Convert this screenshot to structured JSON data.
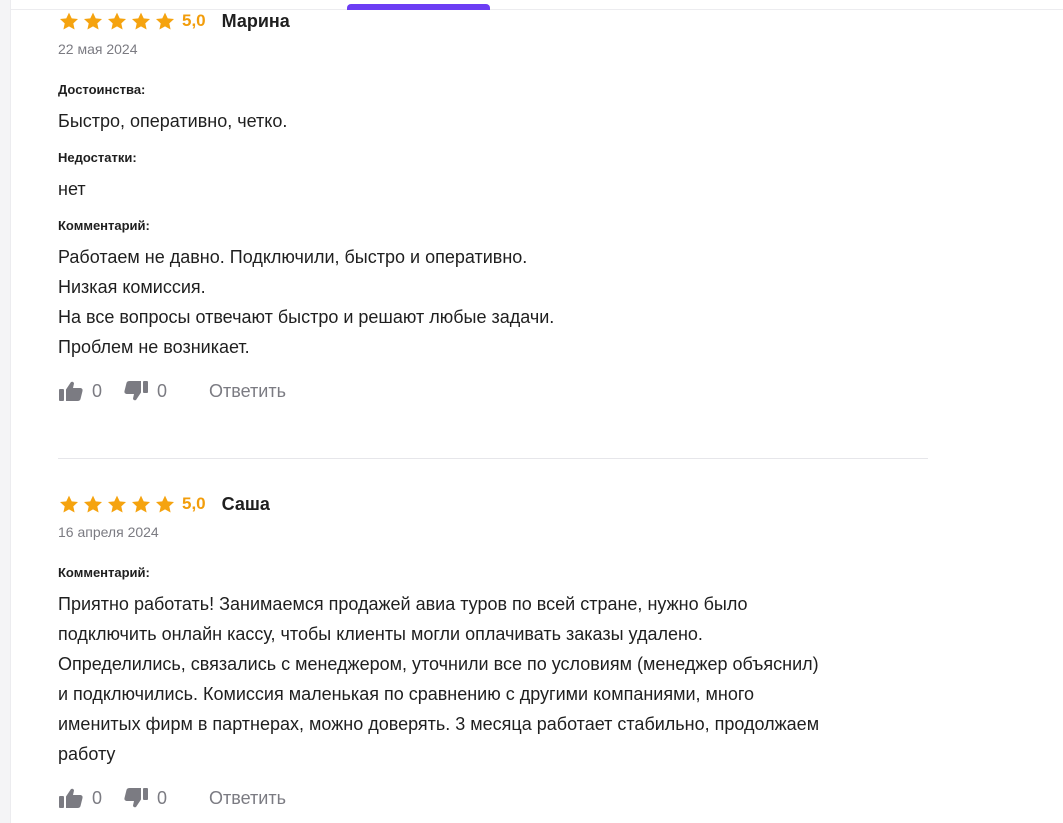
{
  "reviews": [
    {
      "stars": 5,
      "rating": "5,0",
      "author": "Марина",
      "date": "22 мая 2024",
      "sections": [
        {
          "label": "Достоинства:",
          "lines": [
            "Быстро, оперативно, четко."
          ]
        },
        {
          "label": "Недостатки:",
          "lines": [
            "нет"
          ]
        },
        {
          "label": "Комментарий:",
          "lines": [
            "Работаем не давно. Подключили, быстро и оперативно.",
            "Низкая комиссия.",
            "На все вопросы отвечают быстро и решают любые задачи.",
            "Проблем не возникает."
          ]
        }
      ],
      "likes": "0",
      "dislikes": "0",
      "reply_label": "Ответить"
    },
    {
      "stars": 5,
      "rating": "5,0",
      "author": "Саша",
      "date": "16 апреля 2024",
      "sections": [
        {
          "label": "Комментарий:",
          "lines": [
            "Приятно работать! Занимаемся продажей авиа туров по всей стране, нужно было",
            "подключить онлайн кассу, чтобы клиенты могли оплачивать заказы удалено.",
            "Определились, связались с менеджером, уточнили все по условиям (менеджер объяснил)",
            "и подключились. Комиссия маленькая по сравнению с другими компаниями, много",
            "именитых фирм в партнерах, можно доверять. 3 месяца работает стабильно, продолжаем",
            "работу"
          ]
        }
      ],
      "likes": "0",
      "dislikes": "0",
      "reply_label": "Ответить"
    }
  ],
  "colors": {
    "star": "#f5a30f",
    "rating": "#f29d0b",
    "accent": "#6c3df4",
    "muted": "#7b7b82",
    "text": "#1f1f1f"
  },
  "icons": {
    "star": "star-icon",
    "like": "thumbs-up-icon",
    "dislike": "thumbs-down-icon"
  }
}
